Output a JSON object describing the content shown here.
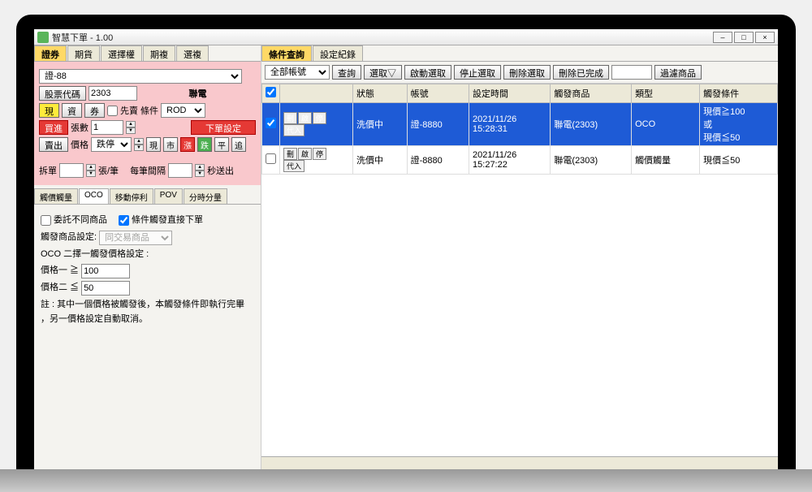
{
  "window": {
    "title": "智慧下單 - 1.00"
  },
  "topTabs": [
    "證券",
    "期貨",
    "選擇權",
    "期複",
    "選複"
  ],
  "topTabActive": 0,
  "account": "證-88",
  "stockCodeLabel": "股票代碼",
  "stockCode": "2303",
  "stockName": "聯電",
  "btns": {
    "cash": "現",
    "margin": "資",
    "short": "券",
    "dayTrade": "先賣",
    "condLabel": "條件",
    "rod": "ROD"
  },
  "buy": "買進",
  "sell": "賣出",
  "qtyLabel": "張數",
  "qty": "1",
  "orderSetting": "下單設定",
  "priceLabel": "價格",
  "priceType": "跌停",
  "priceBtns": {
    "now": "現",
    "market": "市",
    "up": "漲",
    "down": "跌",
    "flat": "平",
    "trace": "追"
  },
  "splitLabel": "拆單",
  "splitUnit": "張/筆",
  "intervalLabel": "每筆間隔",
  "intervalUnit": "秒送出",
  "subTabs": [
    "觸價觸量",
    "OCO",
    "移動停利",
    "POV",
    "分時分量"
  ],
  "subTabActive": 1,
  "oco": {
    "diff": "委託不同商品",
    "direct": "條件觸發直接下單",
    "prodLabel": "觸發商品設定:",
    "prodValue": "同交易商品",
    "title": "OCO 二擇一觸發價格設定 :",
    "p1label": "價格一  ≧",
    "p1": "100",
    "p2label": "價格二  ≦",
    "p2": "50",
    "note1": "註 : 其中一個價格被觸發後，本觸發條件即執行完畢",
    "note2": "      ，另一價格設定自動取消。"
  },
  "rightTabs": [
    "條件查詢",
    "設定紀錄"
  ],
  "rightTabActive": 0,
  "toolbar": {
    "acctSel": "全部帳號",
    "query": "查詢",
    "selAll": "選取▽",
    "start": "啟動選取",
    "stop": "停止選取",
    "delSel": "刪除選取",
    "delDone": "刪除已完成",
    "filter": "過濾商品"
  },
  "gridHeaders": [
    "",
    "",
    "狀態",
    "帳號",
    "設定時間",
    "觸發商品",
    "類型",
    "觸發條件"
  ],
  "gridRows": [
    {
      "sel": true,
      "status": "洗價中",
      "acct": "證-8880",
      "time": "2021/11/26 15:28:31",
      "prod": "聯電(2303)",
      "type": "OCO",
      "cond": "現價≧100\n或\n現價≦50"
    },
    {
      "sel": false,
      "status": "洗價中",
      "acct": "證-8880",
      "time": "2021/11/26 15:27:22",
      "prod": "聯電(2303)",
      "type": "觸價觸量",
      "cond": "現價≦50"
    }
  ],
  "cellBtns": [
    "刪",
    "啟",
    "停",
    "代入"
  ]
}
